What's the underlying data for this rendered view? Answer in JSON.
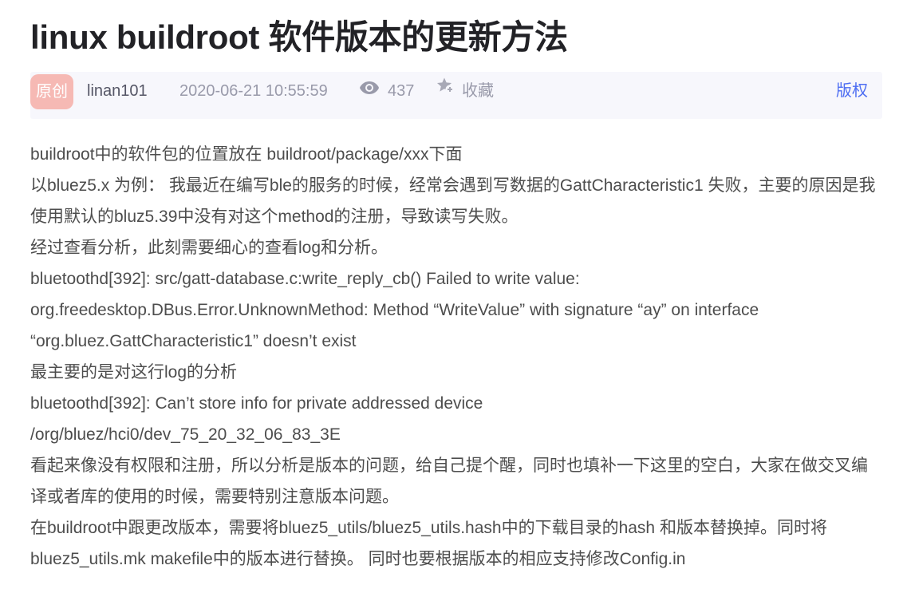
{
  "article": {
    "title": "linux buildroot 软件版本的更新方法"
  },
  "meta": {
    "badge": "原创",
    "author": "linan101",
    "publish_time": "2020-06-21 10:55:59",
    "views_icon": "eye-icon",
    "views": "437",
    "collect_icon": "star-collect-icon",
    "collect_label": "收藏",
    "copyright_label": "版权"
  },
  "colors": {
    "title": "#222226",
    "body_text": "#4d4d4d",
    "meta_text": "#999aaa",
    "author": "#555666",
    "badge_bg": "#f6b9b4",
    "meta_bg": "#f7f7fc",
    "link": "#4e6ef2"
  },
  "body": {
    "paragraphs": [
      "buildroot中的软件包的位置放在 buildroot/package/xxx下面",
      "以bluez5.x 为例： 我最近在编写ble的服务的时候，经常会遇到写数据的GattCharacteristic1 失败，主要的原因是我使用默认的bluz5.39中没有对这个method的注册，导致读写失败。",
      "经过查看分析，此刻需要细心的查看log和分析。",
      "bluetoothd[392]: src/gatt-database.c:write_reply_cb() Failed to write value:",
      "org.freedesktop.DBus.Error.UnknownMethod: Method “WriteValue” with signature “ay” on interface “org.bluez.GattCharacteristic1” doesn’t exist",
      "最主要的是对这行log的分析",
      "bluetoothd[392]: Can’t store info for private addressed device",
      "/org/bluez/hci0/dev_75_20_32_06_83_3E",
      "看起来像没有权限和注册，所以分析是版本的问题，给自己提个醒，同时也填补一下这里的空白，大家在做交叉编译或者库的使用的时候，需要特别注意版本问题。",
      "在buildroot中跟更改版本，需要将bluez5_utils/bluez5_utils.hash中的下载目录的hash 和版本替换掉。同时将bluez5_utils.mk makefile中的版本进行替换。 同时也要根据版本的相应支持修改Config.in"
    ]
  }
}
